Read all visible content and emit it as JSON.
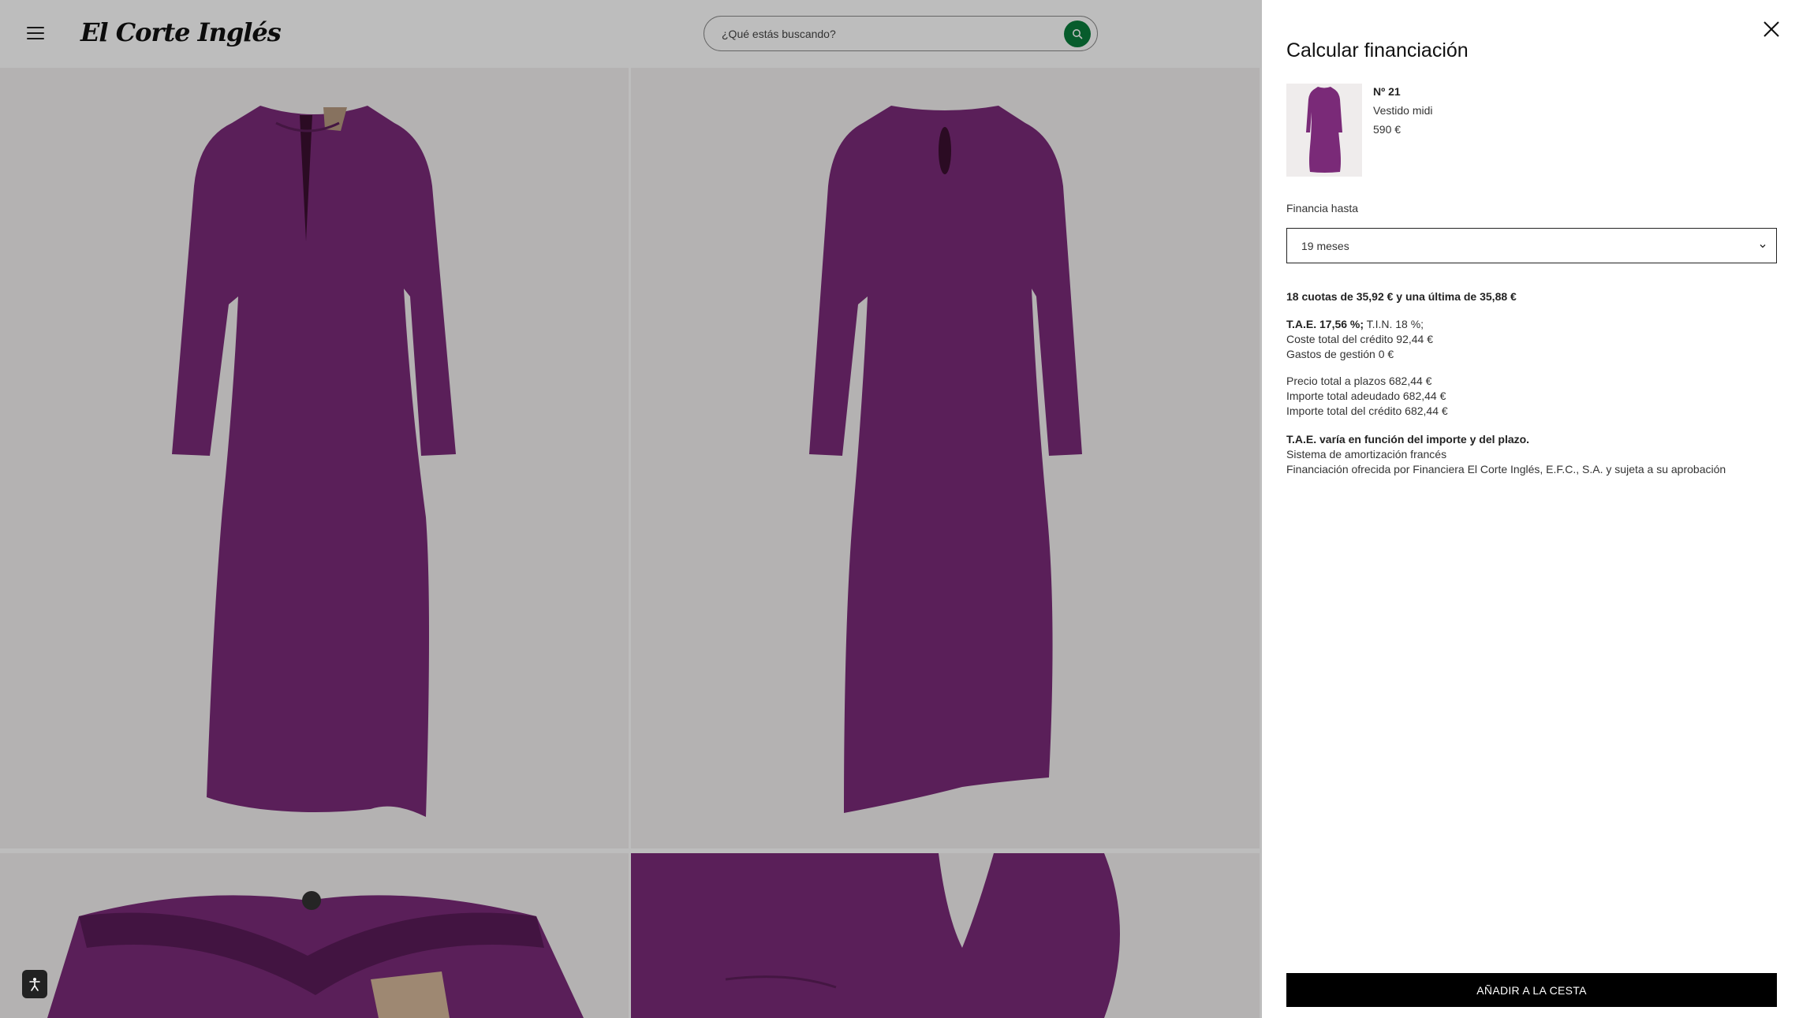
{
  "header": {
    "logo_text": "El Corte Inglés",
    "search_placeholder": "¿Qué estás buscando?"
  },
  "drawer": {
    "title": "Calcular financiación",
    "product": {
      "brand": "Nº 21",
      "name": "Vestido midi",
      "price": "590 €"
    },
    "financing_label": "Financia hasta",
    "term_selected": "19 meses",
    "installments_summary": "18 cuotas de 35,92 € y una última de 35,88 €",
    "tae_label": "T.A.E. 17,56 %;",
    "tin_label": " T.I.N. 18 %;",
    "total_credit_cost": "Coste total del crédito 92,44 €",
    "management_fees": "Gastos de gestión 0 €",
    "total_price_installments": "Precio total a plazos 682,44 €",
    "total_amount_owed": "Importe total adeudado 682,44 €",
    "total_credit_amount": "Importe total del crédito 682,44 €",
    "tae_note": "T.A.E. varía en función del importe y del plazo.",
    "amortization": "Sistema de amortización francés",
    "provider_note": "Financiación ofrecida por Financiera El Corte Inglés, E.F.C., S.A. y sujeta a su aprobación",
    "add_to_cart": "AÑADIR A LA CESTA"
  },
  "colors": {
    "accent_green": "#0a7d3c",
    "dress_purple": "#7a2a78",
    "overlay": "rgba(0,0,0,0.26)"
  },
  "icons": [
    "hamburger-menu-icon",
    "search-icon",
    "close-icon",
    "chevron-down-icon",
    "accessibility-icon"
  ]
}
